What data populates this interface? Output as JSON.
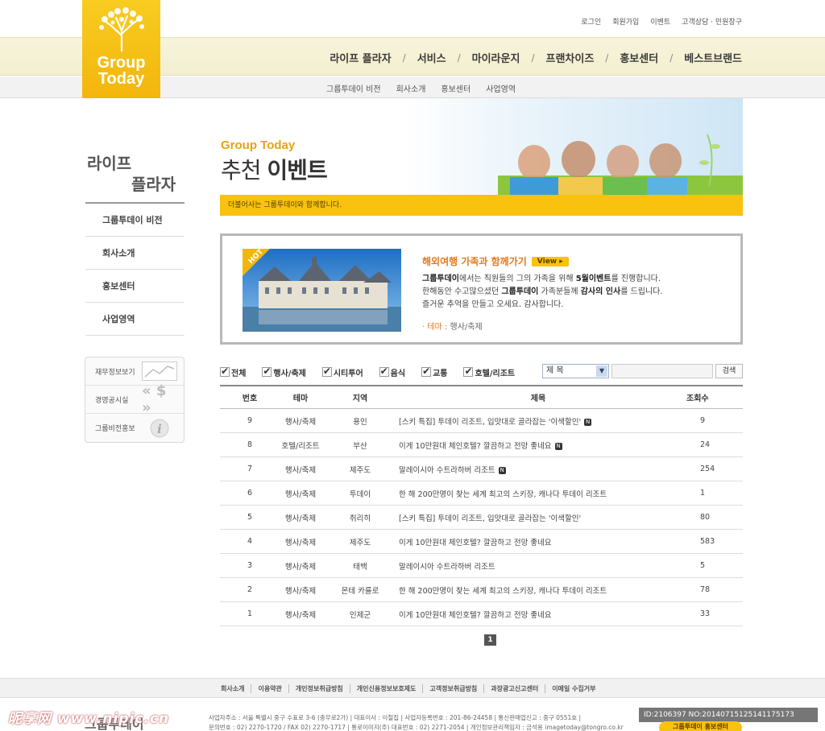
{
  "header": {
    "logo": {
      "line1": "Group",
      "line2": "Today"
    },
    "util_links": [
      "로그인",
      "회원가입",
      "이벤트",
      "고객상담 · 민원창구"
    ],
    "gnb": [
      "라이프 플라자",
      "서비스",
      "마이라운지",
      "프랜차이즈",
      "홍보센터",
      "베스트브랜드"
    ],
    "gnb_separator": "/",
    "snb": [
      "그룹투데이 비전",
      "회사소개",
      "홍보센터",
      "사업영역"
    ]
  },
  "sidebar": {
    "title_line1": "라이프",
    "title_line2": "플라자",
    "items": [
      "그룹투데이 비전",
      "회사소개",
      "홍보센터",
      "사업영역"
    ],
    "quick": [
      {
        "label": "재무정보보기",
        "icon": "chart-icon"
      },
      {
        "label": "경영공시실",
        "icon": "dollar-icon"
      },
      {
        "label": "그룹비전홍보",
        "icon": "info-icon"
      }
    ]
  },
  "visual": {
    "subtitle": "Group Today",
    "title_light": "추천 ",
    "title_bold": "이벤트",
    "notice": "더불어사는 그룹투데이와 함께합니다."
  },
  "feature": {
    "badge": "HOT",
    "title": "해외여행 가족과 함께가기",
    "view_label": "View ▸",
    "desc": [
      {
        "pre": "",
        "b1": "그룹투데이",
        "mid": "에서는 직원들의 그의 가족을 위해 ",
        "b2": "5월이벤트",
        "post": "를 진행합니다."
      },
      {
        "pre": "한해동안 수고많으셨던 ",
        "b1": "그룹투데이",
        "mid": " 가족분들께 ",
        "b2": "감사의 인사",
        "post": "를 드립니다."
      },
      {
        "pre": "즐거운 추억을 만들고 오세요. 감사합니다.",
        "b1": "",
        "mid": "",
        "b2": "",
        "post": ""
      }
    ],
    "theme_key": "· 테마 :",
    "theme_value": "행사/축제"
  },
  "filters": {
    "checks": [
      "전체",
      "행사/축제",
      "시티투어",
      "음식",
      "교통",
      "호텔/리조트"
    ],
    "select_value": "제 목",
    "search_button": "검색"
  },
  "table": {
    "headers": [
      "번호",
      "테마",
      "지역",
      "제목",
      "조회수"
    ],
    "rows": [
      {
        "no": "9",
        "theme": "행사/축제",
        "region": "용인",
        "title": "[스키 특집] 투데이 리조트, 입맛대로 골라잡는 '이색할인'",
        "new": true,
        "views": "9"
      },
      {
        "no": "8",
        "theme": "호텔/리조트",
        "region": "부산",
        "title": "이게 10만원대 체인호텔? 깔끔하고 전망 좋네요",
        "new": true,
        "views": "24"
      },
      {
        "no": "7",
        "theme": "행사/축제",
        "region": "제주도",
        "title": "말레이시아 수트라하버 리조트",
        "new": true,
        "views": "254"
      },
      {
        "no": "6",
        "theme": "행사/축제",
        "region": "투데이",
        "title": "한 해 200만명이 찾는 세계 최고의 스키장, 캐나다 투데이 리조트",
        "new": false,
        "views": "1"
      },
      {
        "no": "5",
        "theme": "행사/축제",
        "region": "취리히",
        "title": "[스키 특집] 투데이 리조트, 입맛대로 골라잡는 '이색할인'",
        "new": false,
        "views": "80"
      },
      {
        "no": "4",
        "theme": "행사/축제",
        "region": "제주도",
        "title": "이게 10만원대 체인호텔? 깔끔하고 전망 좋네요",
        "new": false,
        "views": "583"
      },
      {
        "no": "3",
        "theme": "행사/축제",
        "region": "태백",
        "title": "말레이시아 수트라하버 리조트",
        "new": false,
        "views": "5"
      },
      {
        "no": "2",
        "theme": "행사/축제",
        "region": "몬테 카를로",
        "title": "한 해 200만명이 찾는 세계 최고의 스키장, 캐나다 투데이 리조트",
        "new": false,
        "views": "78"
      },
      {
        "no": "1",
        "theme": "행사/축제",
        "region": "인제군",
        "title": "이게 10만원대 체인호텔? 깔끔하고 전망 좋네요",
        "new": false,
        "views": "33"
      }
    ],
    "new_badge": "N",
    "page": "1"
  },
  "footer": {
    "links": [
      "회사소개",
      "이용약관",
      "개인정보취급방침",
      "개인신용정보보호제도",
      "고객정보취급방침",
      "과장광고신고센터",
      "이메일 수집거부"
    ],
    "logo_text": "그룹투데이",
    "info_line1": "사업자주소 : 서울 특별시 중구 수표로 3-6 (충무로2가) | 대표이사 : 이철집 | 사업자등록번호 : 201-86-24458 | 통신판매업신고 : 중구 0551호 |",
    "info_line2": "문의번호 : 02) 2270-1720 / FAX 02) 2270-1717 | 통로이미지(주) 대표번호 : 02) 2271-2054 | 개인정보관리책임자 : 금석용 imagetoday@tongro.co.kr",
    "button": "그룹투데이 홍보센터",
    "watermark_left": "昵享网 www.nipic.cn",
    "watermark_right": "ID:2106397 NO:20140715125141175173"
  },
  "colors": {
    "accent": "#f8c20f",
    "orange": "#e5791b",
    "logo_yellow": "#f5bd14"
  }
}
